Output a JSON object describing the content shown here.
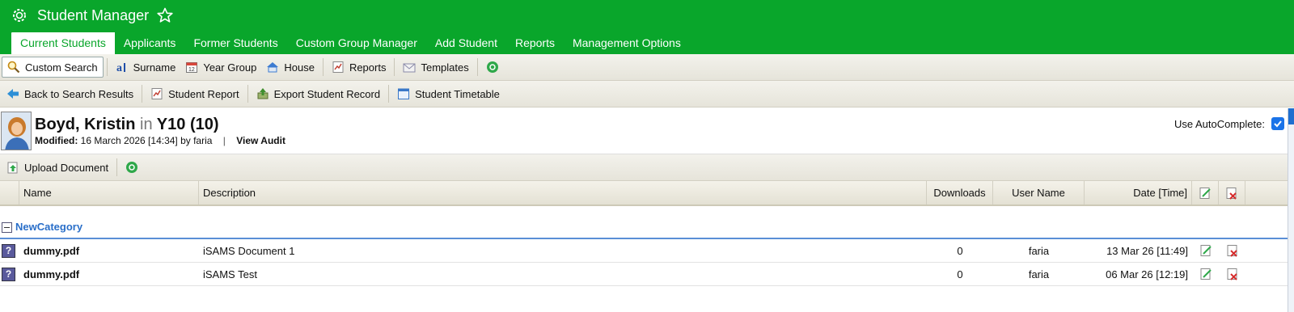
{
  "app": {
    "title": "Student Manager",
    "icon": "gear-badge-icon",
    "favorite_icon": "star-outline-icon"
  },
  "tabs": [
    {
      "label": "Current Students",
      "active": true
    },
    {
      "label": "Applicants"
    },
    {
      "label": "Former Students"
    },
    {
      "label": "Custom Group Manager"
    },
    {
      "label": "Add Student"
    },
    {
      "label": "Reports"
    },
    {
      "label": "Management Options"
    }
  ],
  "toolbar1": {
    "custom_search": "Custom Search",
    "surname": "Surname",
    "year_group": "Year Group",
    "house": "House",
    "reports": "Reports",
    "templates": "Templates"
  },
  "toolbar2": {
    "back": "Back to Search Results",
    "student_report": "Student Report",
    "export": "Export Student Record",
    "timetable": "Student Timetable"
  },
  "student": {
    "name": "Boyd, Kristin",
    "in": "in",
    "group": "Y10 (10)",
    "modified_label": "Modified:",
    "modified_value": "16 March 2026 [14:34] by faria",
    "separator": "|",
    "view_audit": "View Audit",
    "autocomplete_label": "Use AutoComplete:",
    "autocomplete_checked": true
  },
  "documents_toolbar": {
    "upload": "Upload Document"
  },
  "table": {
    "headers": {
      "name": "Name",
      "description": "Description",
      "downloads": "Downloads",
      "user_name": "User Name",
      "date": "Date [Time]"
    },
    "category": "NewCategory",
    "rows": [
      {
        "name": "dummy.pdf",
        "description": "iSAMS Document 1",
        "downloads": "0",
        "user": "faria",
        "date": "13 Mar 26 [11:49]"
      },
      {
        "name": "dummy.pdf",
        "description": "iSAMS Test",
        "downloads": "0",
        "user": "faria",
        "date": "06 Mar 26 [12:19]"
      }
    ]
  },
  "colors": {
    "brand_green": "#09a62b",
    "category_blue": "#2a6fc9",
    "checkbox_blue": "#1a73e8"
  }
}
